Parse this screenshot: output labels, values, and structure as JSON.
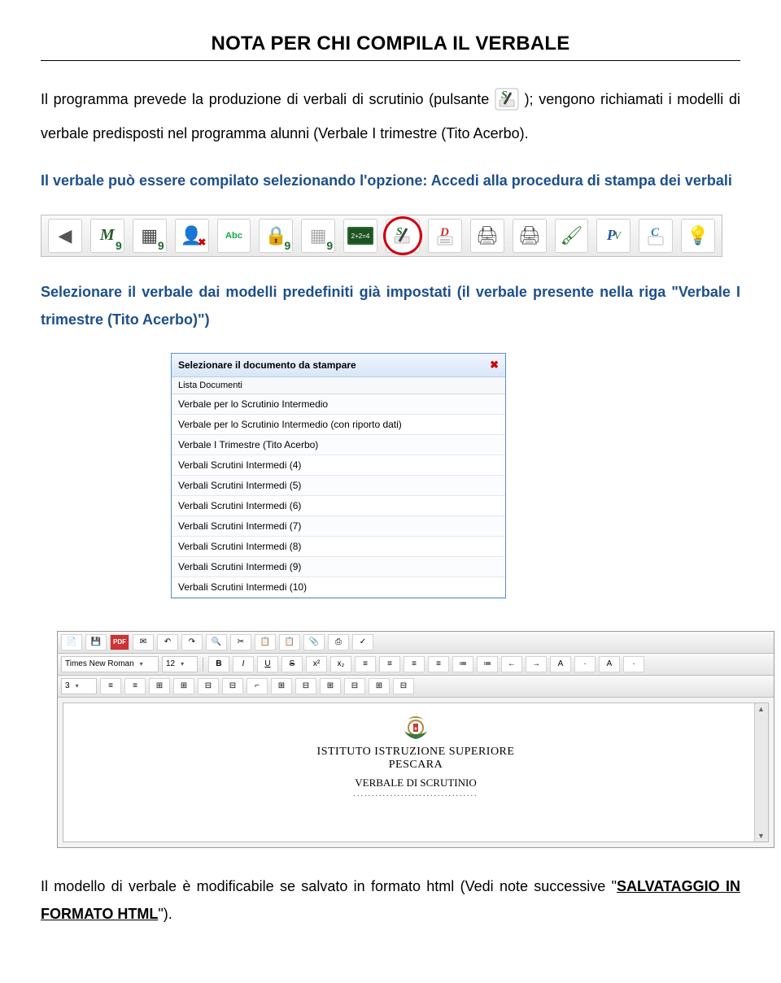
{
  "title": "NOTA PER CHI COMPILA IL VERBALE",
  "para1_a": "Il programma prevede la produzione di verbali di scrutinio (pulsante ",
  "para1_b": " ); vengono richiamati i modelli di verbale predisposti nel programma alunni (Verbale I trimestre (Tito Acerbo).",
  "para2": "Il verbale può essere compilato selezionando l'opzione: Accedi alla procedura di stampa dei verbali",
  "toolbar_icons": [
    {
      "name": "back-icon",
      "glyph": "◀",
      "color": "#c33"
    },
    {
      "name": "m-icon",
      "glyph": "M",
      "num": "9",
      "ital": true,
      "col": "#2a5a2a"
    },
    {
      "name": "grid-icon",
      "glyph": "▦",
      "num": "9",
      "col": "#444"
    },
    {
      "name": "user-remove-icon",
      "glyph": "👤",
      "badge": "✖"
    },
    {
      "name": "abc-icon",
      "glyph": "Abc",
      "num": "",
      "small": true,
      "col": "#1a4"
    },
    {
      "name": "lock-icon",
      "glyph": "🔒",
      "num": "9"
    },
    {
      "name": "grid2-icon",
      "glyph": "▦",
      "num": "9",
      "col": "#aaa"
    },
    {
      "name": "board-icon",
      "glyph": "▆",
      "col": "#2a6a2a",
      "text": "2+2=4"
    },
    {
      "name": "s-pen-icon",
      "glyph": "S",
      "pen": true,
      "circled": true,
      "scol": "#2a7a2a"
    },
    {
      "name": "d-doc-icon",
      "glyph": "D",
      "dcol": "#c33"
    },
    {
      "name": "print-icon",
      "glyph": "🖨"
    },
    {
      "name": "print2-icon",
      "glyph": "🖨"
    },
    {
      "name": "brush-icon",
      "glyph": "🖌",
      "col": "#2a7a2a"
    },
    {
      "name": "pv-icon",
      "glyph": "P",
      "small2": "V"
    },
    {
      "name": "c-doc-icon",
      "glyph": "C",
      "ccol": "#28a"
    },
    {
      "name": "bulb-icon",
      "glyph": "💡"
    }
  ],
  "para3": "Selezionare il verbale dai modelli predefiniti già impostati (il verbale presente nella riga \"Verbale I trimestre (Tito Acerbo)\")",
  "dialog": {
    "title": "Selezionare il documento da stampare",
    "subtitle": "Lista Documenti",
    "rows": [
      "Verbale per lo Scrutinio Intermedio",
      "Verbale per lo Scrutinio Intermedio (con riporto dati)",
      "Verbale I Trimestre (Tito Acerbo)",
      "Verbali Scrutini Intermedi (4)",
      "Verbali Scrutini Intermedi (5)",
      "Verbali Scrutini Intermedi (6)",
      "Verbali Scrutini Intermedi (7)",
      "Verbali Scrutini Intermedi (8)",
      "Verbali Scrutini Intermedi (9)",
      "Verbali Scrutini Intermedi (10)"
    ]
  },
  "rte": {
    "font_family": "Times New Roman",
    "font_size": "12",
    "row1": [
      "📄",
      "💾",
      "PDF",
      "✉",
      "↶",
      "↷",
      "🔍",
      "✂",
      "📋",
      "📋",
      "📎",
      "⎙",
      "✓"
    ],
    "row2": [
      "B",
      "I",
      "U",
      "S",
      "x²",
      "x₂",
      "≡",
      "≡",
      "≡",
      "≡",
      "≔",
      "≔",
      "←",
      "→",
      "A",
      "·",
      "A",
      "·"
    ],
    "row3": [
      "3",
      "≡",
      "≡",
      "⊞",
      "⊞",
      "⊟",
      "⊟",
      "⌐",
      "⊞",
      "⊟",
      "⊞",
      "⊟",
      "⊞",
      "⊟"
    ],
    "doc_h1": "ISTITUTO ISTRUZIONE SUPERIORE",
    "doc_h2": "PESCARA",
    "doc_h3": "VERBALE DI SCRUTINIO"
  },
  "para4_a": "Il modello di verbale è modificabile se  salvato in formato html (Vedi note successive \"",
  "para4_link": "SALVATAGGIO IN FORMATO HTML",
  "para4_b": "\")."
}
